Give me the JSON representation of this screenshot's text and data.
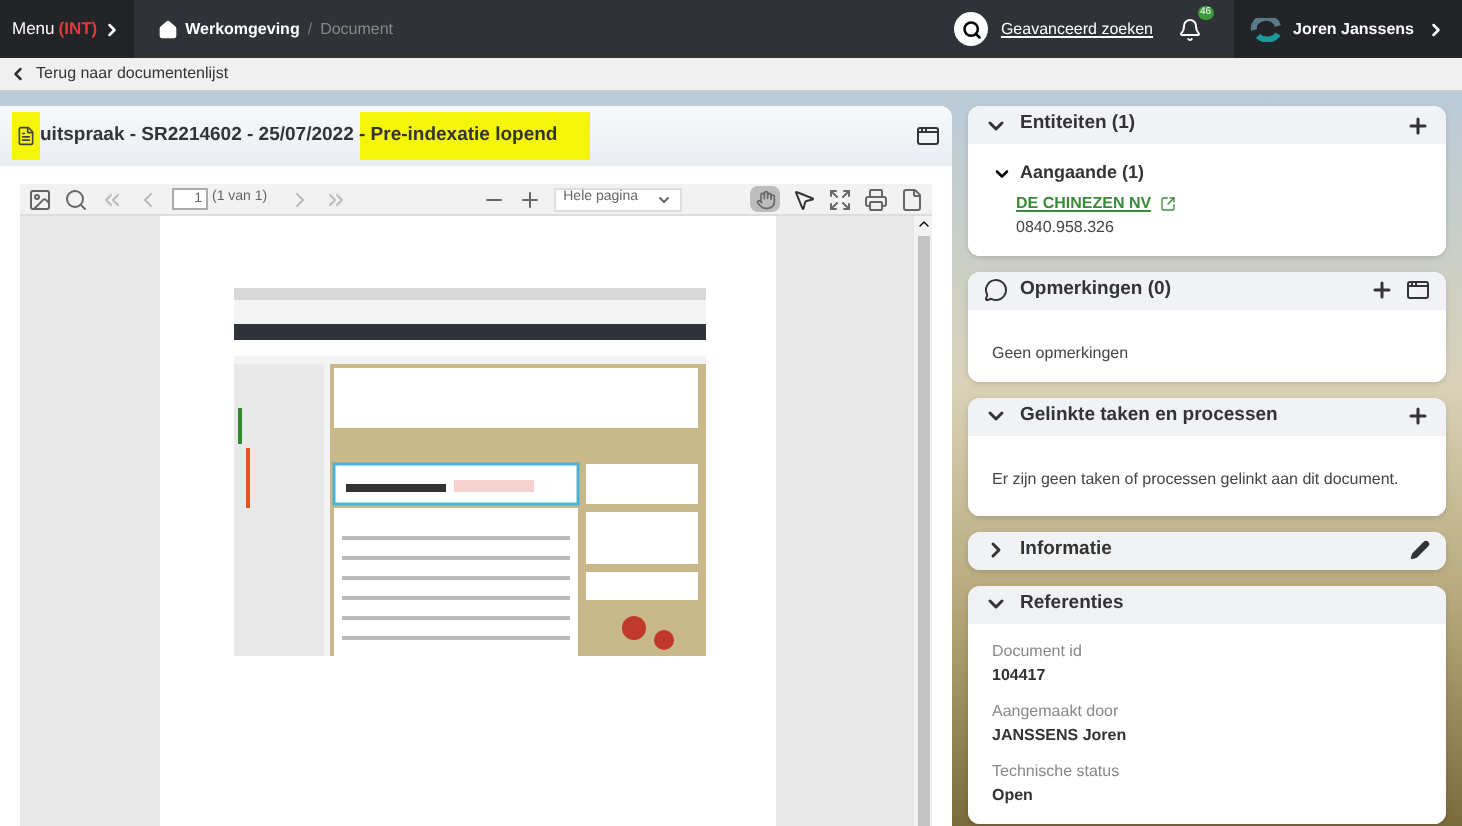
{
  "topbar": {
    "menu_label": "Menu",
    "menu_env": "(INT)",
    "breadcrumb_separator": "/",
    "breadcrumbs": [
      {
        "label": "Werkomgeving",
        "current": false
      },
      {
        "label": "Document",
        "current": true
      }
    ],
    "search_link": "Geavanceerd zoeken",
    "notification_count": "46",
    "user_name": "Joren Janssens"
  },
  "back_link": "Terug naar documentenlijst",
  "document": {
    "icon_highlighted": true,
    "title_parts": [
      {
        "text": "uitspraak - SR2214602 - 25/07/2022 ",
        "highlighted": false
      },
      {
        "text": "- Pre-indexatie lopend",
        "highlighted": true
      }
    ],
    "viewer": {
      "page_input": "1",
      "page_count": "(1 van 1)",
      "zoom": "Hele pagina",
      "hand_tool_selected": true
    }
  },
  "panels": [
    {
      "kind": "entities",
      "title": "Entiteiten (1)",
      "expanded": true,
      "groups": [
        {
          "title": "Aangaande (1)",
          "items": [
            {
              "name": "DE CHINEZEN NV",
              "number": "0840.958.326"
            }
          ]
        }
      ]
    },
    {
      "kind": "comments",
      "title": "Opmerkingen (0)",
      "text": "Geen opmerkingen"
    },
    {
      "kind": "text",
      "title": "Gelinkte taken en processen",
      "expanded": true,
      "text": "Er zijn geen taken of processen gelinkt aan dit document."
    },
    {
      "kind": "edit",
      "title": "Informatie",
      "expanded": false
    },
    {
      "kind": "fields",
      "title": "Referenties",
      "expanded": true,
      "fields": [
        {
          "label": "Document id",
          "value": "104417"
        },
        {
          "label": "Aangemaakt door",
          "value": "JANSSENS Joren"
        },
        {
          "label": "Technische status",
          "value": "Open"
        }
      ]
    }
  ]
}
